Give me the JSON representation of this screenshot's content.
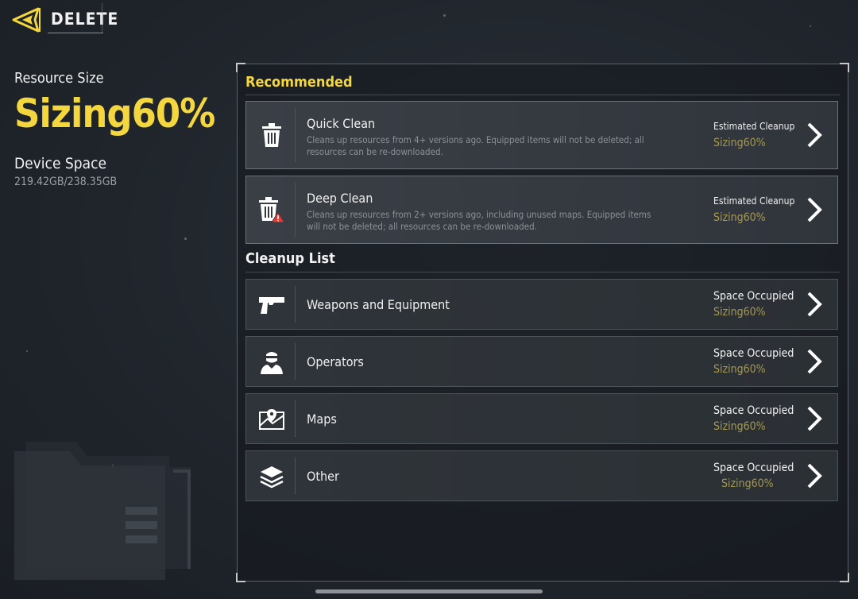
{
  "header": {
    "title": "DELETE"
  },
  "summary": {
    "resource_label": "Resource Size",
    "resource_value": "Sizing60%",
    "device_label": "Device Space",
    "device_value": "219.42GB/238.35GB"
  },
  "recommended": {
    "title": "Recommended",
    "items": [
      {
        "name": "Quick Clean",
        "icon": "trash-icon",
        "description": "Cleans up resources from 4+ versions ago. Equipped items will not be deleted; all resources can be re-downloaded.",
        "right_label": "Estimated Cleanup",
        "right_value": "Sizing60%"
      },
      {
        "name": "Deep Clean",
        "icon": "trash-warning-icon",
        "description": "Cleans up resources from 2+ versions ago, including unused maps. Equipped items will not be deleted; all resources can be re-downloaded.",
        "right_label": "Estimated Cleanup",
        "right_value": "Sizing60%"
      }
    ]
  },
  "cleanup_list": {
    "title": "Cleanup List",
    "items": [
      {
        "name": "Weapons and Equipment",
        "icon": "pistol-icon",
        "right_label": "Space Occupied",
        "right_value": "Sizing60%"
      },
      {
        "name": "Operators",
        "icon": "operator-icon",
        "right_label": "Space Occupied",
        "right_value": "Sizing60%"
      },
      {
        "name": "Maps",
        "icon": "map-icon",
        "right_label": "Space Occupied",
        "right_value": "Sizing60%"
      },
      {
        "name": "Other",
        "icon": "layers-icon",
        "right_label": "Space Occupied",
        "right_value": "Sizing60%"
      }
    ]
  },
  "colors": {
    "accent": "#f4d63e",
    "muted_value": "#a89a45",
    "background": "#22272e"
  }
}
